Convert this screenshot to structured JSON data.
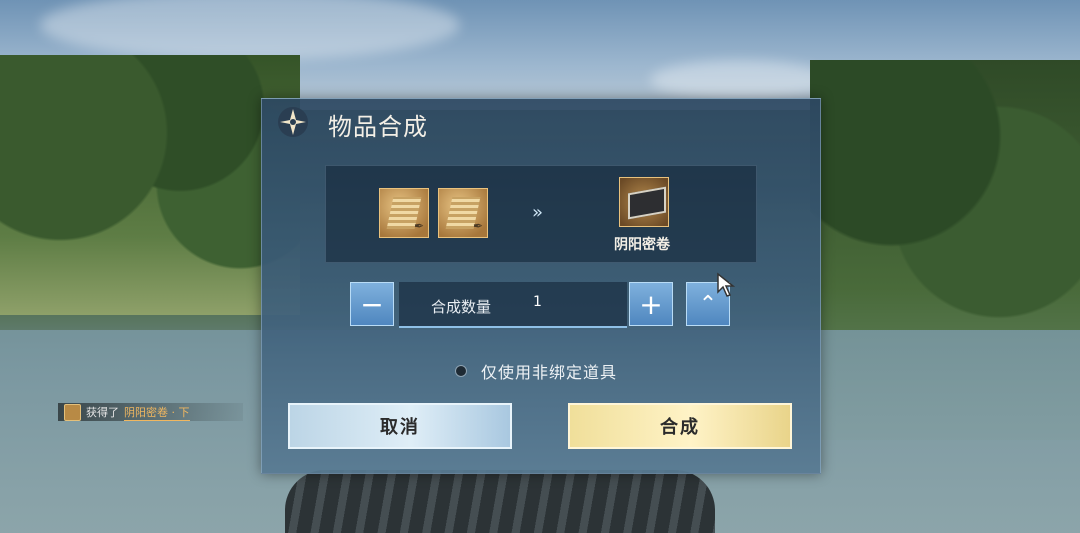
{
  "dialog": {
    "title": "物品合成",
    "materials": [
      {
        "icon": "scroll-fragment-icon"
      },
      {
        "icon": "scroll-fragment-icon"
      }
    ],
    "arrow": "»",
    "result": {
      "icon": "yinyang-scroll-box-icon",
      "name": "阴阳密卷"
    },
    "quantity": {
      "label": "合成数量",
      "value": "1",
      "minus": "−",
      "plus": "+",
      "max": "⌃"
    },
    "option_label": "仅使用非绑定道具",
    "cancel_label": "取消",
    "confirm_label": "合成"
  },
  "notification": {
    "prefix": "获得了",
    "item": "阴阳密卷 · 下"
  },
  "colors": {
    "confirm": "#f3e2a0",
    "cancel": "#cfe3f1",
    "accent_blue": "#5a93c8"
  }
}
